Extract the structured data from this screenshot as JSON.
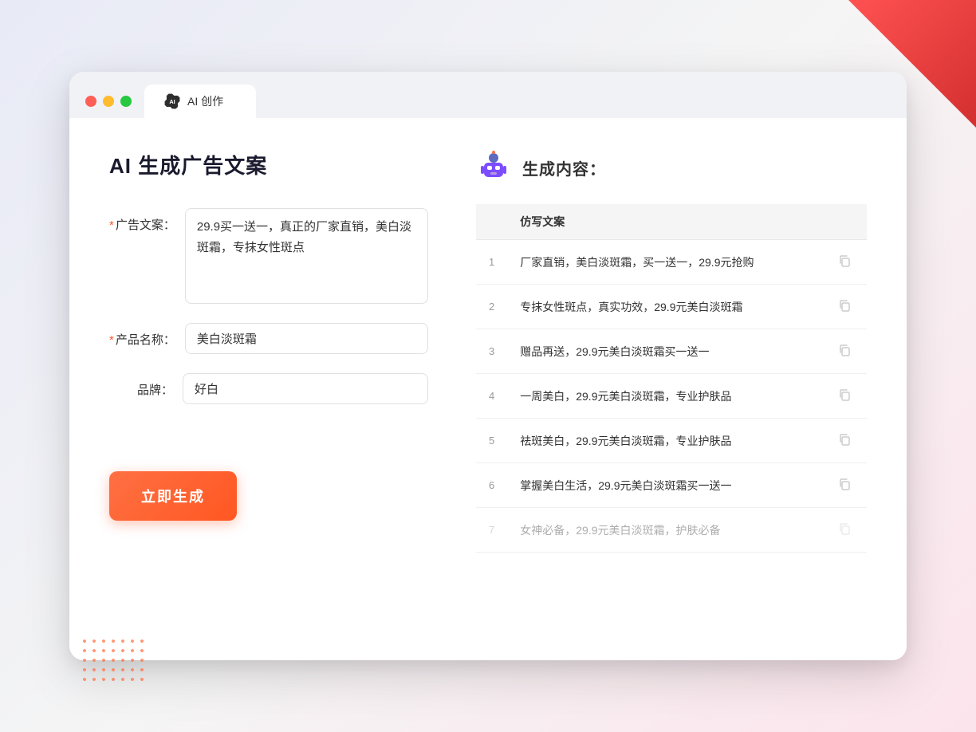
{
  "window": {
    "tab_label": "AI 创作"
  },
  "page": {
    "title": "AI 生成广告文案",
    "result_section_label": "生成内容："
  },
  "form": {
    "ad_copy_label": "广告文案：",
    "ad_copy_required": "*",
    "ad_copy_value": "29.9买一送一，真正的厂家直销，美白淡斑霜，专抹女性斑点",
    "product_name_label": "产品名称：",
    "product_name_required": "*",
    "product_name_value": "美白淡斑霜",
    "brand_label": "品牌：",
    "brand_value": "好白",
    "generate_btn_label": "立即生成"
  },
  "results": {
    "column_header": "仿写文案",
    "items": [
      {
        "num": "1",
        "text": "厂家直销，美白淡斑霜，买一送一，29.9元抢购"
      },
      {
        "num": "2",
        "text": "专抹女性斑点，真实功效，29.9元美白淡斑霜"
      },
      {
        "num": "3",
        "text": "赠品再送，29.9元美白淡斑霜买一送一"
      },
      {
        "num": "4",
        "text": "一周美白，29.9元美白淡斑霜，专业护肤品"
      },
      {
        "num": "5",
        "text": "祛斑美白，29.9元美白淡斑霜，专业护肤品"
      },
      {
        "num": "6",
        "text": "掌握美白生活，29.9元美白淡斑霜买一送一"
      },
      {
        "num": "7",
        "text": "女神必备，29.9元美白淡斑霜，护肤必备",
        "faded": true
      }
    ]
  }
}
